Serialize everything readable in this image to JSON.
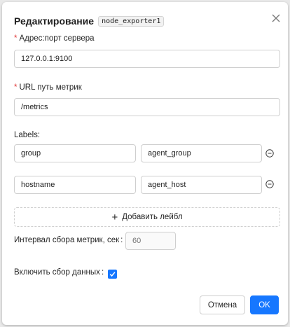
{
  "dialog": {
    "title": "Редактирование",
    "code": "node_exporter1"
  },
  "fields": {
    "address": {
      "label": "Адрес:порт сервера",
      "required_mark": "*",
      "value": "127.0.0.1:9100"
    },
    "metrics_path": {
      "label": "URL путь метрик",
      "required_mark": "*",
      "value": "/metrics"
    }
  },
  "labels": {
    "heading": "Labels:",
    "rows": [
      {
        "key": "group",
        "value": "agent_group"
      },
      {
        "key": "hostname",
        "value": "agent_host"
      }
    ],
    "add_label": "Добавить лейбл"
  },
  "interval": {
    "label": "Интервал сбора метрик, сек",
    "colon": ":",
    "placeholder": "60"
  },
  "collection": {
    "label": "Включить сбор данных",
    "colon": ":",
    "checked": true
  },
  "footer": {
    "cancel": "Отмена",
    "ok": "OK"
  },
  "colors": {
    "primary": "#1677ff",
    "required": "#e03c3c"
  },
  "icons": {
    "close": "close-icon",
    "remove": "minus-circle-icon",
    "add": "plus-icon",
    "check": "check-icon"
  }
}
